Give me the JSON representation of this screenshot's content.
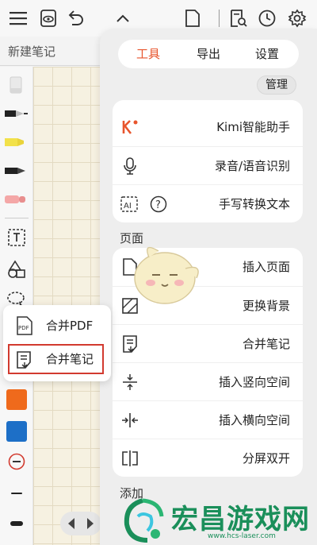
{
  "toolbar": {
    "icons": [
      "menu-icon",
      "eye-icon",
      "undo-icon",
      "chevron-up-icon",
      "page-icon",
      "search-doc-icon",
      "clock-icon",
      "gear-icon"
    ]
  },
  "note": {
    "title": "新建笔记"
  },
  "tabs": [
    {
      "label": "工具",
      "active": true
    },
    {
      "label": "导出",
      "active": false
    },
    {
      "label": "设置",
      "active": false
    }
  ],
  "manage_label": "管理",
  "ai_tools": [
    {
      "icon": "kimi-icon",
      "label": "Kimi智能助手"
    },
    {
      "icon": "microphone-icon",
      "label": "录音/语音识别"
    },
    {
      "icon": "ai-handwriting-icon",
      "label": "手写转换文本"
    }
  ],
  "page_section": {
    "title": "页面",
    "items": [
      {
        "icon": "insert-page-icon",
        "label": "插入页面"
      },
      {
        "icon": "change-background-icon",
        "label": "更换背景"
      },
      {
        "icon": "merge-notes-icon",
        "label": "合并笔记"
      },
      {
        "icon": "vertical-space-icon",
        "label": "插入竖向空间"
      },
      {
        "icon": "horizontal-space-icon",
        "label": "插入横向空间"
      },
      {
        "icon": "split-screen-icon",
        "label": "分屏双开"
      }
    ]
  },
  "add_section": {
    "title": "添加"
  },
  "popup": {
    "items": [
      {
        "icon": "pdf-icon",
        "label": "合并PDF"
      },
      {
        "icon": "merge-notes-icon",
        "label": "合并笔记"
      }
    ]
  },
  "colors": {
    "accent": "#e8552d",
    "swatch_orange": "#ef6a1c",
    "swatch_blue": "#1d6fc7",
    "highlight": "#d23a2f",
    "watermark": "#1a8f5a"
  },
  "watermark": {
    "text": "宏昌游戏网",
    "url": "www.hcs-laser.com"
  }
}
